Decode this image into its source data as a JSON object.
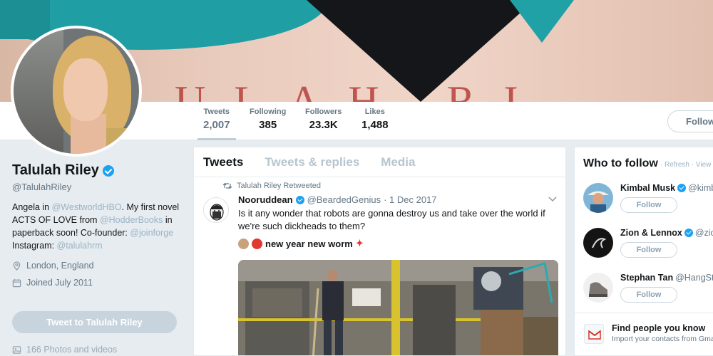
{
  "profile": {
    "name": "Talulah Riley",
    "handle": "@TalulahRiley",
    "bio": {
      "t1": "Angela in ",
      "l1": "@WestworldHBO",
      "t2": ". My first novel ACTS OF LOVE from ",
      "l2": "@HodderBooks",
      "t3": " in paperback soon! Co-founder: ",
      "l3": "@joinforge",
      "t4": " Instagram: ",
      "l4": "@talulahrm"
    },
    "location": "London, England",
    "joined": "Joined July 2011",
    "tweet_to_label": "Tweet to Talulah Riley",
    "photos_label": "166 Photos and videos"
  },
  "stats": [
    {
      "label": "Tweets",
      "value": "2,007"
    },
    {
      "label": "Following",
      "value": "385"
    },
    {
      "label": "Followers",
      "value": "23.3K"
    },
    {
      "label": "Likes",
      "value": "1,488"
    }
  ],
  "follow_label": "Follow",
  "timeline": {
    "tabs": [
      "Tweets",
      "Tweets & replies",
      "Media"
    ],
    "tweet": {
      "retweet_note": "Talulah Riley Retweeted",
      "author_name": "Nooruddean",
      "author_handle": "@BeardedGenius",
      "date": "· 1 Dec 2017",
      "text": "Is it any wonder that robots are gonna destroy us and take over the world if we're such dickheads to them?",
      "subtext": "new year new worm"
    }
  },
  "who_to_follow": {
    "title": "Who to follow",
    "links": "· Refresh · View all",
    "suggestions": [
      {
        "name": "Kimbal Musk",
        "handle": "@kimbal",
        "button": "Follow"
      },
      {
        "name": "Zion & Lennox",
        "handle": "@zionylennox",
        "button": "Follow"
      },
      {
        "name": "Stephan Tan",
        "handle": "@HangSteph",
        "button": "Follow"
      }
    ],
    "find_title": "Find people you know",
    "find_subtitle": "Import your contacts from Gmail"
  },
  "colors": {
    "accent": "#1da1f2",
    "link_faded": "#9bb3c4",
    "banner_teal": "#1f9ea3"
  }
}
